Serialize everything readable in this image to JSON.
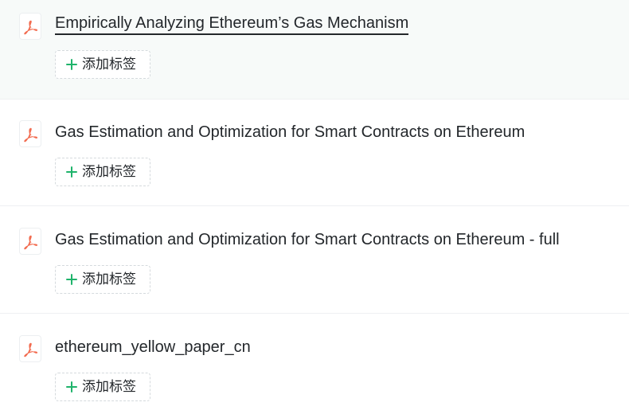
{
  "files": [
    {
      "title": "Empirically Analyzing Ethereum’s Gas Mechanism",
      "icon": "pdf-icon",
      "add_tag_label": "添加标签",
      "hovered": true
    },
    {
      "title": "Gas Estimation and Optimization for Smart Contracts on Ethereum",
      "icon": "pdf-icon",
      "add_tag_label": "添加标签",
      "hovered": false
    },
    {
      "title": "Gas Estimation and Optimization for Smart Contracts on Ethereum - full",
      "icon": "pdf-icon",
      "add_tag_label": "添加标签",
      "hovered": false
    },
    {
      "title": "ethereum_yellow_paper_cn",
      "icon": "pdf-icon",
      "add_tag_label": "添加标签",
      "hovered": false
    }
  ],
  "colors": {
    "pdf_icon": "#f26b4f",
    "plus_icon": "#1fb36b",
    "text": "#23272b",
    "hover_background": "#f7faf9"
  }
}
